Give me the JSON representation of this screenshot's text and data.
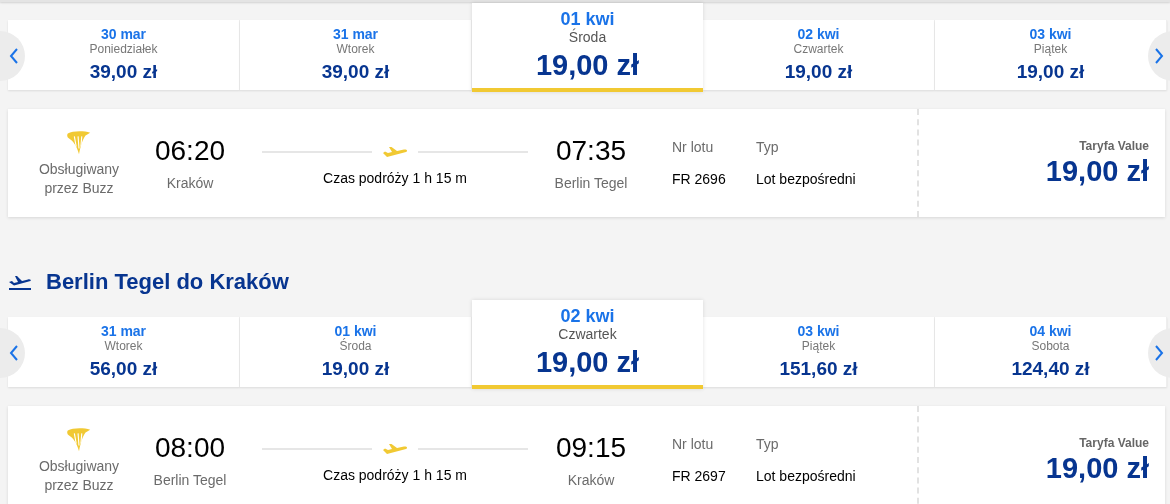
{
  "sections": [
    {
      "dates": [
        {
          "date": "30 mar",
          "weekday": "Poniedziałek",
          "price": "39,00 zł",
          "selected": false
        },
        {
          "date": "31 mar",
          "weekday": "Wtorek",
          "price": "39,00 zł",
          "selected": false
        },
        {
          "date": "01 kwi",
          "weekday": "Środa",
          "price": "19,00 zł",
          "selected": true
        },
        {
          "date": "02 kwi",
          "weekday": "Czwartek",
          "price": "19,00 zł",
          "selected": false
        },
        {
          "date": "03 kwi",
          "weekday": "Piątek",
          "price": "19,00 zł",
          "selected": false
        }
      ],
      "flight": {
        "operator": "Obsługiwany przez Buzz",
        "departure_time": "06:20",
        "departure_city": "Kraków",
        "duration": "Czas podróży 1 h 15 m",
        "arrival_time": "07:35",
        "arrival_city": "Berlin Tegel",
        "flight_no_label": "Nr lotu",
        "flight_no": "FR 2696",
        "type_label": "Typ",
        "type": "Lot bezpośredni",
        "fare_label": "Taryfa Value",
        "fare_price": "19,00 zł"
      }
    },
    {
      "heading": "Berlin Tegel do Kraków",
      "dates": [
        {
          "date": "31 mar",
          "weekday": "Wtorek",
          "price": "56,00 zł",
          "selected": false
        },
        {
          "date": "01 kwi",
          "weekday": "Środa",
          "price": "19,00 zł",
          "selected": false
        },
        {
          "date": "02 kwi",
          "weekday": "Czwartek",
          "price": "19,00 zł",
          "selected": true
        },
        {
          "date": "03 kwi",
          "weekday": "Piątek",
          "price": "151,60 zł",
          "selected": false
        },
        {
          "date": "04 kwi",
          "weekday": "Sobota",
          "price": "124,40 zł",
          "selected": false
        }
      ],
      "flight": {
        "operator": "Obsługiwany przez Buzz",
        "departure_time": "08:00",
        "departure_city": "Berlin Tegel",
        "duration": "Czas podróży 1 h 15 m",
        "arrival_time": "09:15",
        "arrival_city": "Kraków",
        "flight_no_label": "Nr lotu",
        "flight_no": "FR 2697",
        "type_label": "Typ",
        "type": "Lot bezpośredni",
        "fare_label": "Taryfa Value",
        "fare_price": "19,00 zł"
      }
    }
  ]
}
